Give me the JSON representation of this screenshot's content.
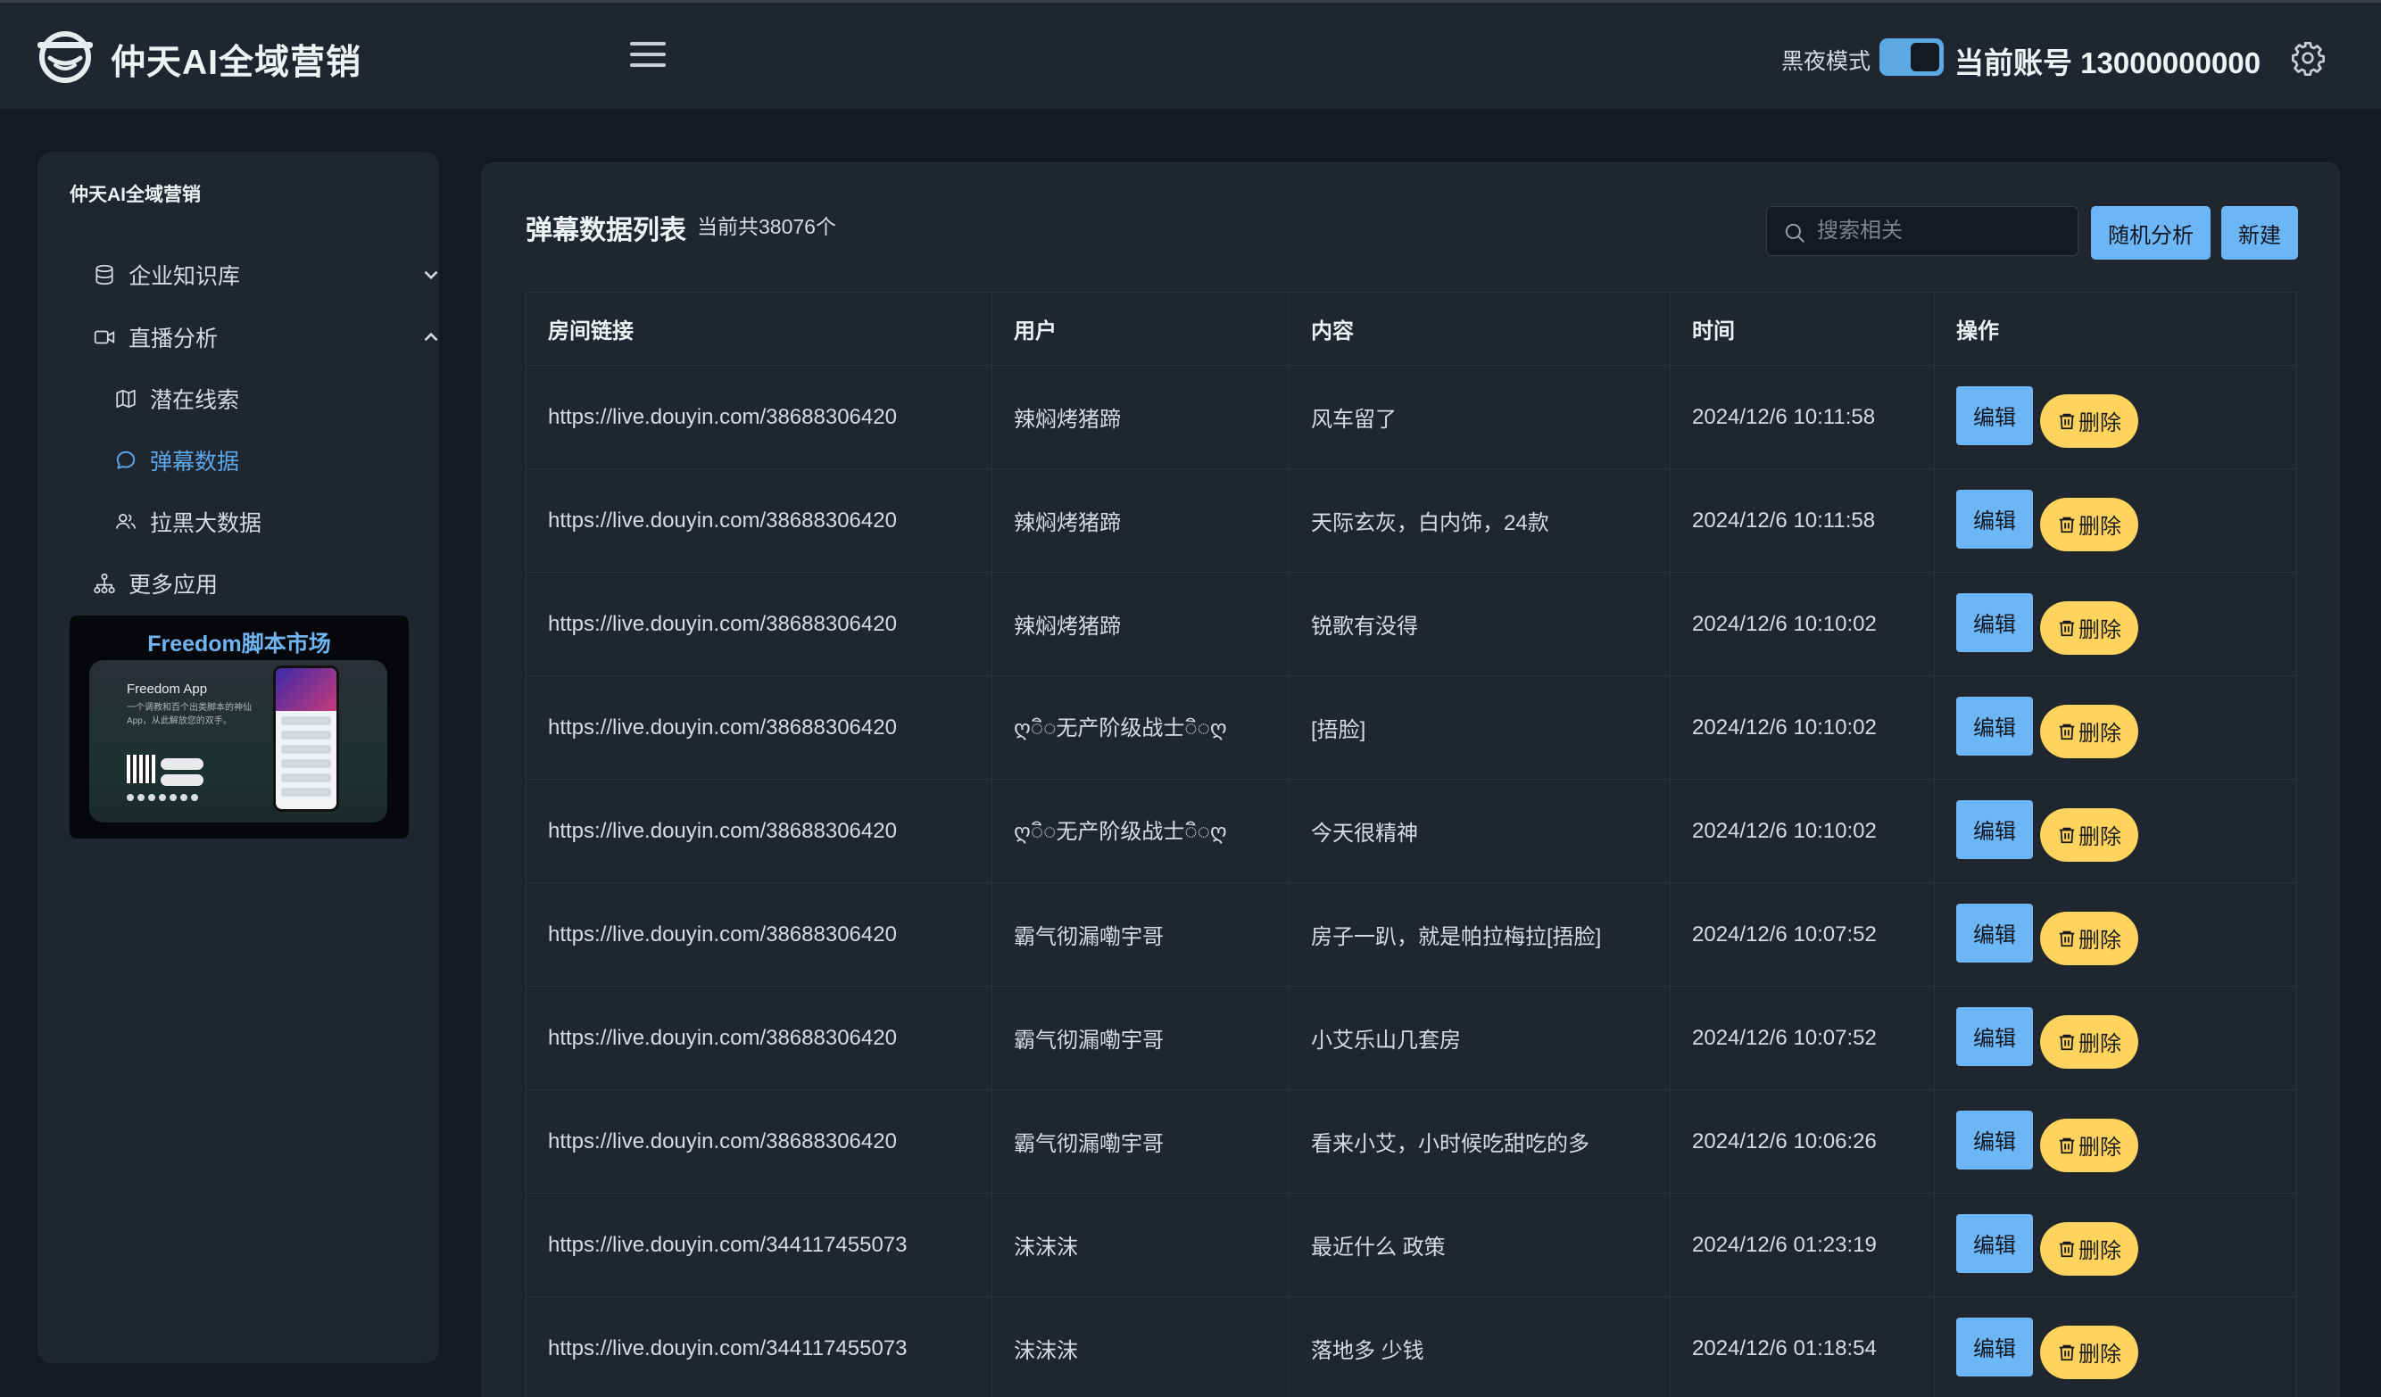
{
  "header": {
    "app_title": "仲天AI全域营销",
    "dark_mode_label": "黑夜模式",
    "dark_mode_on": true,
    "account_text": "当前账号 13000000000"
  },
  "sidebar": {
    "title": "仲天AI全域营销",
    "items": [
      {
        "label": "企业知识库",
        "icon": "database-icon",
        "expanded": false
      },
      {
        "label": "直播分析",
        "icon": "video-icon",
        "expanded": true
      },
      {
        "label": "潜在线索",
        "icon": "map-icon"
      },
      {
        "label": "弹幕数据",
        "icon": "chat-bubble-icon",
        "active": true
      },
      {
        "label": "拉黑大数据",
        "icon": "users-icon"
      },
      {
        "label": "更多应用",
        "icon": "sitemap-icon"
      }
    ],
    "promo": {
      "title": "Freedom脚本市场",
      "app_name": "Freedom App",
      "subtitle": "一个调教和百个出类脚本的神仙App，从此解放您的双手。"
    }
  },
  "main": {
    "title": "弹幕数据列表",
    "count_text": "当前共38076个",
    "search_placeholder": "搜索相关",
    "random_button": "随机分析",
    "new_button": "新建",
    "columns": [
      "房间链接",
      "用户",
      "内容",
      "时间",
      "操作"
    ],
    "edit_label": "编辑",
    "delete_label": "删除",
    "rows": [
      {
        "link": "https://live.douyin.com/38688306420",
        "user": "辣焖烤猪蹄",
        "content": "风车留了",
        "time": "2024/12/6 10:11:58"
      },
      {
        "link": "https://live.douyin.com/38688306420",
        "user": "辣焖烤猪蹄",
        "content": "天际玄灰，白内饰，24款",
        "time": "2024/12/6 10:11:58"
      },
      {
        "link": "https://live.douyin.com/38688306420",
        "user": "辣焖烤猪蹄",
        "content": "锐歌有没得",
        "time": "2024/12/6 10:10:02"
      },
      {
        "link": "https://live.douyin.com/38688306420",
        "user": "ღ◌ิ◌无产阶级战士◌ิ◌ღ",
        "content": "[捂脸]",
        "time": "2024/12/6 10:10:02"
      },
      {
        "link": "https://live.douyin.com/38688306420",
        "user": "ღ◌ิ◌无产阶级战士◌ิ◌ღ",
        "content": "今天很精神",
        "time": "2024/12/6 10:10:02"
      },
      {
        "link": "https://live.douyin.com/38688306420",
        "user": "霸气彻漏嘞宇哥",
        "content": "房子一趴，就是帕拉梅拉[捂脸]",
        "time": "2024/12/6 10:07:52"
      },
      {
        "link": "https://live.douyin.com/38688306420",
        "user": "霸气彻漏嘞宇哥",
        "content": "小艾乐山几套房",
        "time": "2024/12/6 10:07:52"
      },
      {
        "link": "https://live.douyin.com/38688306420",
        "user": "霸气彻漏嘞宇哥",
        "content": "看来小艾，小时候吃甜吃的多",
        "time": "2024/12/6 10:06:26"
      },
      {
        "link": "https://live.douyin.com/344117455073",
        "user": "沫沫沫",
        "content": "最近什么 政策",
        "time": "2024/12/6 01:23:19"
      },
      {
        "link": "https://live.douyin.com/344117455073",
        "user": "沫沫沫",
        "content": "落地多 少钱",
        "time": "2024/12/6 01:18:54"
      }
    ]
  },
  "colors": {
    "accent_blue": "#6cb6f5",
    "delete_yellow": "#ffd45e",
    "active_text": "#5aa7ea",
    "panel_bg": "#20262f",
    "page_bg": "#141922"
  }
}
